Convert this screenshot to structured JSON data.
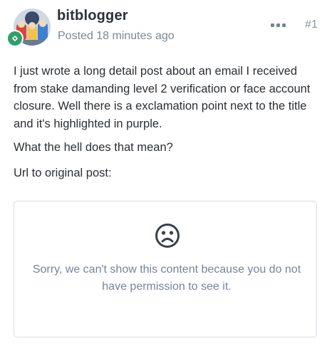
{
  "post": {
    "username": "bitblogger",
    "posted": "Posted 18 minutes ago",
    "number": "#1",
    "paragraphs": [
      "I just wrote a long detail post about an email I received from stake damanding level 2 verification or face account closure. Well there is a exclamation point next to the title and it's highlighted in purple.",
      "What the hell does that mean?",
      "Url to original post:"
    ]
  },
  "embed": {
    "message": "Sorry, we can't show this content because you do not have permission to see it."
  },
  "icons": {
    "more": "ellipsis-icon",
    "badge": "gear-badge-icon",
    "embed": "sad-face-icon"
  },
  "colors": {
    "badge_green": "#2f9e6b",
    "muted_text": "#7c8794",
    "embed_text": "#77839a",
    "border": "#d8dee5"
  }
}
